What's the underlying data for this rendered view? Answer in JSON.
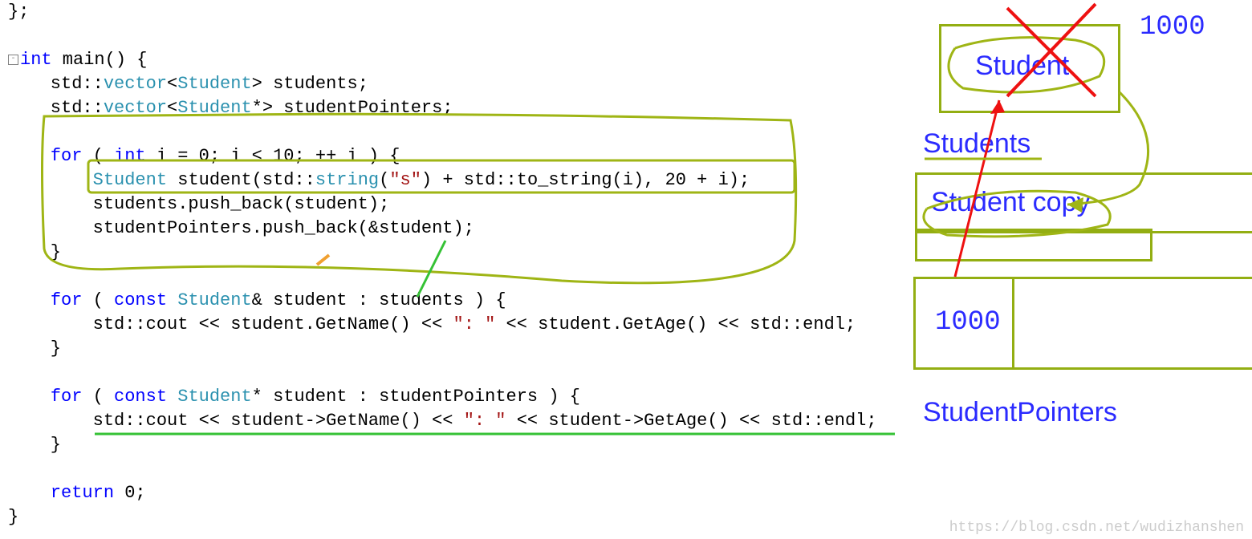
{
  "code": {
    "line1": "};",
    "main_decl_int": "int",
    "main_decl_rest": " main() {",
    "vec1_pre": "    std::",
    "vec1_vector": "vector",
    "vec1_open": "<",
    "vec1_type": "Student",
    "vec1_post": "> students;",
    "vec2_pre": "    std::",
    "vec2_vector": "vector",
    "vec2_open": "<",
    "vec2_type": "Student",
    "vec2_post": "*> studentPointers;",
    "for1_pre": "    ",
    "for1_for": "for",
    "for1_paren": " ( ",
    "for1_int": "int",
    "for1_cond": " i = 0; i < 10; ++ i ) {",
    "stu_decl_pre": "        ",
    "stu_decl_type": "Student",
    "stu_decl_mid": " student(std::",
    "stu_decl_string": "string",
    "stu_decl_paren": "(",
    "stu_decl_lit": "\"s\"",
    "stu_decl_post": ") + std::to_string(i), 20 + i);",
    "push1": "        students.push_back(student);",
    "push2": "        studentPointers.push_back(&student);",
    "brace1": "    }",
    "for2_pre": "    ",
    "for2_for": "for",
    "for2_paren": " ( ",
    "for2_const": "const",
    "for2_sp": " ",
    "for2_type": "Student",
    "for2_post": "& student : students ) {",
    "cout1_pre": "        std::cout << student.GetName() << ",
    "cout1_lit": "\": \"",
    "cout1_post": " << student.GetAge() << std::endl;",
    "brace2": "    }",
    "for3_pre": "    ",
    "for3_for": "for",
    "for3_paren": " ( ",
    "for3_const": "const",
    "for3_sp": " ",
    "for3_type": "Student",
    "for3_post": "* student : studentPointers ) {",
    "cout2_pre": "        std::cout << student->GetName() << ",
    "cout2_lit": "\": \"",
    "cout2_post": " << student->GetAge() << std::endl;",
    "brace3": "    }",
    "ret_pre": "    ",
    "ret_kw": "return",
    "ret_val": " 0;",
    "brace4": "}"
  },
  "diagram": {
    "addr_top": "1000",
    "student": "Student",
    "students_label": "Students",
    "student_copy": "Student copy",
    "addr_bottom": "1000",
    "pointers_label": "StudentPointers"
  },
  "watermark": "https://blog.csdn.net/wudizhanshen"
}
